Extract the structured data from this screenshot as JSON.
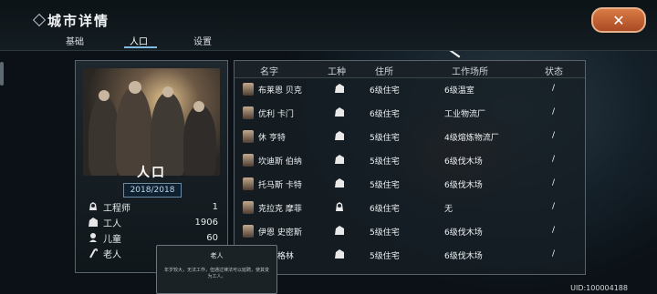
{
  "header": {
    "title": "城市详情",
    "tabs": [
      {
        "label": "基础",
        "active": false
      },
      {
        "label": "人口",
        "active": true
      },
      {
        "label": "设置",
        "active": false
      }
    ],
    "close_icon": "close-x-icon"
  },
  "population_panel": {
    "group_name": "人口",
    "count": "2018/2018",
    "stats": [
      {
        "icon": "engineer-icon",
        "label": "工程师",
        "value": "1"
      },
      {
        "icon": "worker-icon",
        "label": "工人",
        "value": "1906"
      },
      {
        "icon": "child-icon",
        "label": "儿童",
        "value": "60"
      },
      {
        "icon": "elder-icon",
        "label": "老人",
        "value": ""
      }
    ]
  },
  "tooltip": {
    "title": "老人",
    "description": "年岁较大，无法工作，但通过律法可以延聘，使其变为工人。"
  },
  "table": {
    "columns": [
      "名字",
      "工种",
      "住所",
      "工作场所",
      "状态"
    ],
    "rows": [
      {
        "name": "布莱恩 贝克",
        "job_icon": "worker-icon",
        "home": "6级住宅",
        "workplace": "6级温室",
        "status": "/"
      },
      {
        "name": "优利 卡门",
        "job_icon": "worker-icon",
        "home": "6级住宅",
        "workplace": "工业物流厂",
        "status": "/"
      },
      {
        "name": "休 亨特",
        "job_icon": "worker-icon",
        "home": "5级住宅",
        "workplace": "4级熔炼物流厂",
        "status": "/"
      },
      {
        "name": "坎迪斯 伯纳",
        "job_icon": "worker-icon",
        "home": "5级住宅",
        "workplace": "6级伐木场",
        "status": "/"
      },
      {
        "name": "托马斯 卡特",
        "job_icon": "worker-icon",
        "home": "5级住宅",
        "workplace": "6级伐木场",
        "status": "/"
      },
      {
        "name": "克拉克 摩菲",
        "job_icon": "engineer-icon",
        "home": "6级住宅",
        "workplace": "无",
        "status": "/"
      },
      {
        "name": "伊恩 史密斯",
        "job_icon": "worker-icon",
        "home": "5级住宅",
        "workplace": "6级伐木场",
        "status": "/"
      },
      {
        "name": "…伊 格林",
        "job_icon": "worker-icon",
        "home": "5级住宅",
        "workplace": "6级伐木场",
        "status": "/"
      }
    ]
  },
  "uid": "UID:100004188",
  "colors": {
    "accent_tab": "#7fb9e0",
    "close_button": "#c8633a"
  }
}
